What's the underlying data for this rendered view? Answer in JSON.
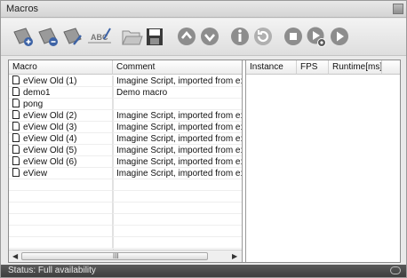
{
  "window": {
    "title": "Macros"
  },
  "toolbar": {
    "buttons": [
      {
        "icon": "macro-new-icon"
      },
      {
        "icon": "macro-delete-icon"
      },
      {
        "icon": "macro-properties-icon"
      },
      {
        "icon": "macro-rename-icon",
        "label": "ABC"
      },
      {
        "icon": "open-folder-icon"
      },
      {
        "icon": "save-icon"
      },
      {
        "icon": "move-up-icon"
      },
      {
        "icon": "move-down-icon"
      },
      {
        "icon": "info-icon"
      },
      {
        "icon": "refresh-icon"
      },
      {
        "icon": "stop-icon"
      },
      {
        "icon": "run-with-settings-icon"
      },
      {
        "icon": "play-icon"
      }
    ]
  },
  "macros_table": {
    "columns": [
      "Macro",
      "Comment"
    ],
    "rows": [
      {
        "macro": "eView Old (1)",
        "comment": "Imagine Script, imported from e:cue Patc"
      },
      {
        "macro": "demo1",
        "comment": "Demo macro"
      },
      {
        "macro": "pong",
        "comment": ""
      },
      {
        "macro": "eView Old (2)",
        "comment": "Imagine Script, imported from e:cue Patc"
      },
      {
        "macro": "eView Old (3)",
        "comment": "Imagine Script, imported from e:cue Patc"
      },
      {
        "macro": "eView Old (4)",
        "comment": "Imagine Script, imported from e:cue Patc"
      },
      {
        "macro": "eView Old (5)",
        "comment": "Imagine Script, imported from e:cue Patc"
      },
      {
        "macro": "eView Old (6)",
        "comment": "Imagine Script, imported from e:cue Patc"
      },
      {
        "macro": "eView",
        "comment": "Imagine Script, imported from e:cue Patc"
      }
    ]
  },
  "running_table": {
    "columns": [
      "Instance",
      "FPS",
      "Runtime[ms]"
    ]
  },
  "scrollbar": {
    "grip": "III"
  },
  "status": {
    "text": "Status: Full availability"
  },
  "colors": {
    "accent_blue": "#3d63a6",
    "icon_gray": "#8d8d8d",
    "status_bg": "#474747"
  }
}
